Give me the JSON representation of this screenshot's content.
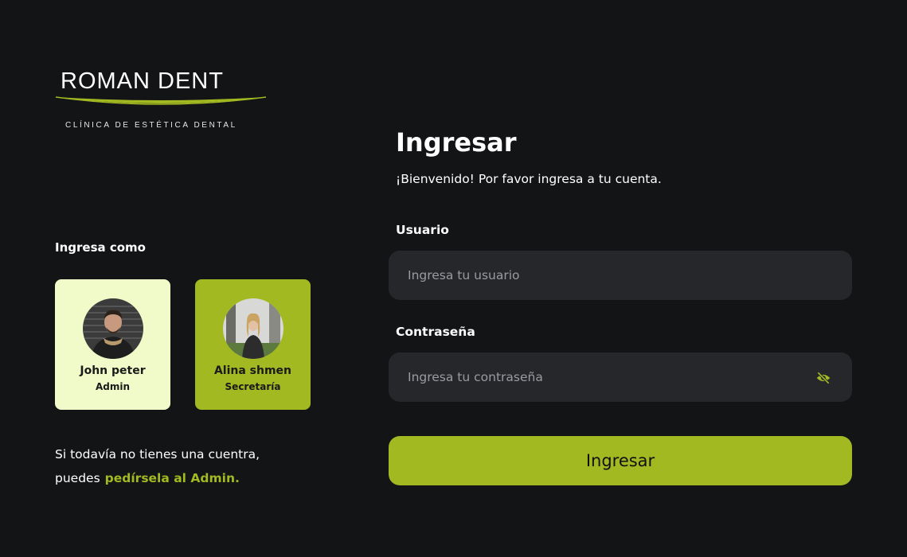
{
  "logo": {
    "name": "ROMAN DENT",
    "tagline": "CLÍNICA DE ESTÉTICA DENTAL",
    "accent_color": "#a2b922"
  },
  "role_select": {
    "title": "Ingresa como",
    "roles": [
      {
        "name": "John peter",
        "role": "Admin",
        "background": "#f1fbc9"
      },
      {
        "name": "Alina shmen",
        "role": "Secretaría",
        "background": "#a2b922"
      }
    ]
  },
  "signup": {
    "line1": "Si todavía no tienes una cuentra,",
    "line2_prefix": "puedes",
    "link": "pedírsela al Admin."
  },
  "form": {
    "title": "Ingresar",
    "subtitle": "¡Bienvenido! Por favor ingresa a tu cuenta.",
    "username_label": "Usuario",
    "username_placeholder": "Ingresa tu usuario",
    "password_label": "Contraseña",
    "password_placeholder": "Ingresa tu contraseña",
    "password_toggle_icon": "eye-off-icon",
    "submit_label": "Ingresar"
  },
  "colors": {
    "background": "#131416",
    "input_background": "#26272b",
    "accent": "#a2b922"
  }
}
